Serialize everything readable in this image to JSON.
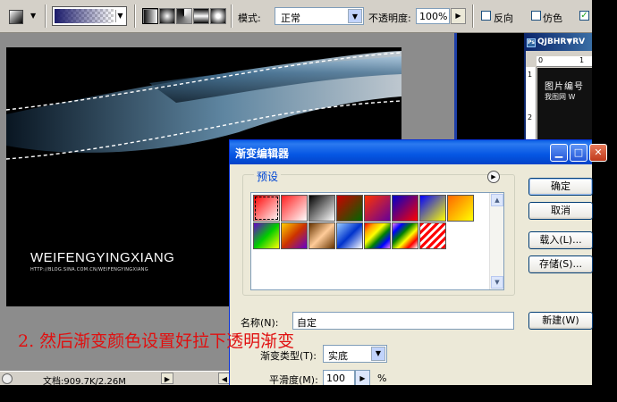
{
  "options_bar": {
    "mode_label": "模式:",
    "mode_value": "正常",
    "opacity_label": "不透明度:",
    "opacity_value": "100%",
    "reverse_label": "反向",
    "dither_label": "仿色",
    "transparency_checked_glyph": "✓"
  },
  "canvas": {
    "watermark_title": "WEIFENGYINGXIANG",
    "watermark_url": "HTTP://BLOG.SINA.COM.CN/WEIFENGYINGXIANG"
  },
  "annotation": "2. 然后渐变颜色设置好拉下透明渐变",
  "status_bar": {
    "doc_info": "文档:909.7K/2.26M"
  },
  "doc2": {
    "title": "QJBHR▼RV",
    "ps_badge": "Ps",
    "ruler_top": [
      "0",
      "1"
    ],
    "ruler_left": [
      "1",
      "2"
    ],
    "image_line1": "图片编号",
    "image_line2": "我图网  W"
  },
  "gradient_editor": {
    "title": "渐变编辑器",
    "presets_label": "预设",
    "ok": "确定",
    "cancel": "取消",
    "load": "载入(L)...",
    "save": "存储(S)...",
    "new": "新建(W)",
    "name_label": "名称(N):",
    "name_value": "自定",
    "type_label": "渐变类型(T):",
    "type_value": "实底",
    "smooth_label": "平滑度(M):",
    "smooth_value": "100",
    "smooth_unit": "%",
    "presets": [
      {
        "gradient": "linear-gradient(135deg,#ff0000,#ffffff)"
      },
      {
        "gradient": "linear-gradient(135deg,#ff2020 0%,rgba(255,0,0,0) 100%)"
      },
      {
        "gradient": "linear-gradient(135deg,#000000,#ffffff)"
      },
      {
        "gradient": "linear-gradient(135deg,#cc0000,#006600)"
      },
      {
        "gradient": "linear-gradient(135deg,#ff3300,#660099)"
      },
      {
        "gradient": "linear-gradient(135deg,#0000cc,#ff0000)"
      },
      {
        "gradient": "linear-gradient(135deg,#0000ff,#ffff00)"
      },
      {
        "gradient": "linear-gradient(135deg,#ff6600,#ffff00)"
      },
      {
        "gradient": "linear-gradient(135deg,#6600cc,#00cc00,#ffff00)"
      },
      {
        "gradient": "linear-gradient(135deg,#ffcc00,#cc3300,#6600cc)"
      },
      {
        "gradient": "linear-gradient(135deg,#663300,#ffcc99,#663300)"
      },
      {
        "gradient": "linear-gradient(135deg,#99ccff,#0033cc,#ffffff)"
      },
      {
        "gradient": "linear-gradient(135deg,red,orange,yellow,green,blue,violet)"
      },
      {
        "gradient": "linear-gradient(135deg,violet,blue,green,yellow,red,#ffffff)"
      },
      {
        "gradient": "repeating-linear-gradient(135deg,#ff0000 0 3px,#ffffff 3px 6px)"
      }
    ]
  }
}
